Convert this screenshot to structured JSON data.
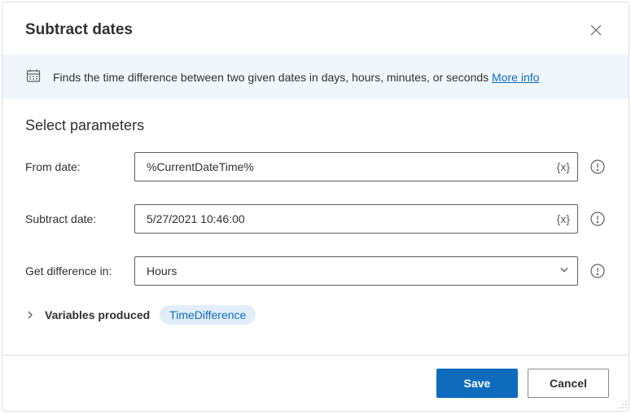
{
  "dialog": {
    "title": "Subtract dates",
    "info_text": "Finds the time difference between two given dates in days, hours, minutes, or seconds",
    "more_info": "More info"
  },
  "section": {
    "title": "Select parameters"
  },
  "params": {
    "from_date": {
      "label": "From date:",
      "value": "%CurrentDateTime%"
    },
    "subtract_date": {
      "label": "Subtract date:",
      "value": "5/27/2021 10:46:00"
    },
    "get_diff": {
      "label": "Get difference in:",
      "value": "Hours"
    }
  },
  "variables": {
    "label": "Variables produced",
    "pill": "TimeDifference"
  },
  "footer": {
    "save": "Save",
    "cancel": "Cancel"
  }
}
